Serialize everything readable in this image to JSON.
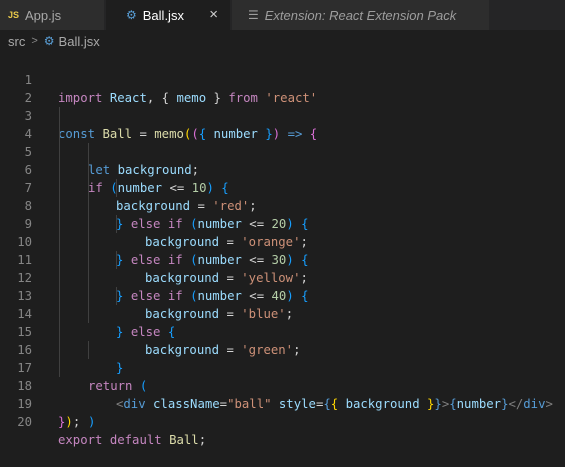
{
  "tabs": [
    {
      "icon": "JS",
      "label": "App.js"
    },
    {
      "icon": "react-gear-icon",
      "label": "Ball.jsx",
      "close": "×"
    },
    {
      "icon": "preview-icon",
      "label": "Extension: React Extension Pack"
    }
  ],
  "breadcrumb": {
    "folder": "src",
    "separator": ">",
    "file": "Ball.jsx"
  },
  "line_numbers": [
    "1",
    "2",
    "3",
    "4",
    "5",
    "6",
    "7",
    "8",
    "9",
    "10",
    "11",
    "12",
    "13",
    "14",
    "15",
    "16",
    "17",
    "18",
    "19",
    "20"
  ],
  "code": {
    "l1": {
      "import": "import",
      "react_id": "React",
      "comma": ",",
      "lb": "{",
      "memo": "memo",
      "rb": "}",
      "from": "from",
      "str": "'react'"
    },
    "l3": {
      "const": "const",
      "name": "Ball",
      "eq": "=",
      "memo": "memo",
      "p1": "(",
      "p2": "(",
      "lb": "{",
      "arg": "number",
      "rb": "}",
      "p3": ")",
      "arrow": "=>",
      "brace": "{"
    },
    "l4": {
      "let": "let",
      "name": "background",
      "semi": ";"
    },
    "l5": {
      "if": "if",
      "open": "(",
      "var": "number",
      "op": "<=",
      "num": "10",
      "close": ")",
      "brace": "{"
    },
    "l6": {
      "var": "background",
      "eq": "=",
      "str": "'red'",
      "semi": ";"
    },
    "l7": {
      "rb": "}",
      "else": "else",
      "if": "if",
      "open": "(",
      "var": "number",
      "op": "<=",
      "num": "20",
      "close": ")",
      "brace": "{"
    },
    "l8": {
      "var": "background",
      "eq": "=",
      "str": "'orange'",
      "semi": ";"
    },
    "l9": {
      "rb": "}",
      "else": "else",
      "if": "if",
      "open": "(",
      "var": "number",
      "op": "<=",
      "num": "30",
      "close": ")",
      "brace": "{"
    },
    "l10": {
      "var": "background",
      "eq": "=",
      "str": "'yellow'",
      "semi": ";"
    },
    "l11": {
      "rb": "}",
      "else": "else",
      "if": "if",
      "open": "(",
      "var": "number",
      "op": "<=",
      "num": "40",
      "close": ")",
      "brace": "{"
    },
    "l12": {
      "var": "background",
      "eq": "=",
      "str": "'blue'",
      "semi": ";"
    },
    "l13": {
      "rb": "}",
      "else": "else",
      "brace": "{"
    },
    "l14": {
      "var": "background",
      "eq": "=",
      "str": "'green'",
      "semi": ";"
    },
    "l15": {
      "rb": "}"
    },
    "l16": {
      "return": "return",
      "open": "("
    },
    "l17": {
      "lt": "<",
      "tag": "div",
      "attr1": "className",
      "eq1": "=",
      "val1": "\"ball\"",
      "attr2": "style",
      "eq2": "=",
      "ob1": "{",
      "ob2": "{",
      "var": "background",
      "cb2": "}",
      "cb1": "}",
      "gt": ">",
      "eb1": "{",
      "child": "number",
      "eb2": "}",
      "close_lt": "</",
      "close_tag": "div",
      "close_gt": ">"
    },
    "l18": {
      "close": ")"
    },
    "l19": {
      "brace": "}",
      "paren": ")",
      "semi": ";"
    },
    "l20": {
      "export": "export",
      "default": "default",
      "name": "Ball",
      "semi": ";"
    }
  }
}
